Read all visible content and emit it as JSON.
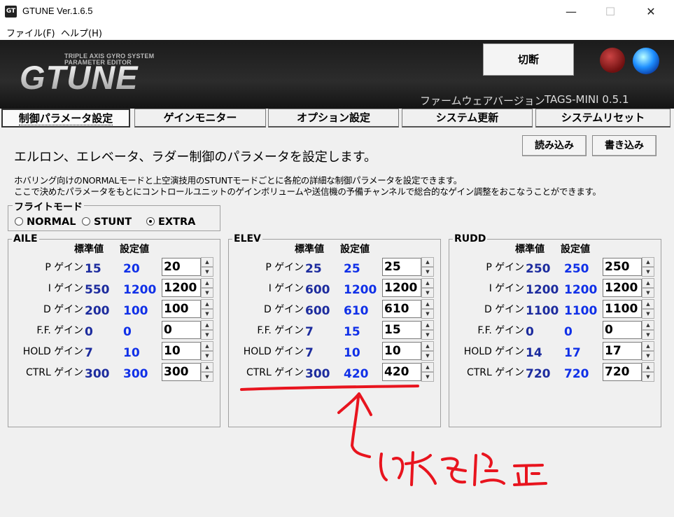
{
  "window": {
    "title": "GTUNE Ver.1.6.5",
    "icon": "GT"
  },
  "menu": [
    {
      "label": "ファイル(F)"
    },
    {
      "label": "ヘルプ(H)"
    }
  ],
  "header": {
    "logo_sub_line1": "TRIPLE AXIS GYRO SYSTEM",
    "logo_sub_line2": "PARAMETER EDITOR",
    "logo_main": "GTUNE",
    "connect_label": "切断",
    "firmware_label": "ファームウェアバージョン",
    "firmware_value": "TAGS-MINI  0.5.1"
  },
  "tabs": [
    {
      "label": "制御パラメータ設定",
      "active": true
    },
    {
      "label": "ゲインモニター"
    },
    {
      "label": "オプション設定"
    },
    {
      "label": "システム更新"
    },
    {
      "label": "システムリセット"
    }
  ],
  "content": {
    "headline": "エルロン、エレベータ、ラダー制御のパラメータを設定します。",
    "desc1": "ホバリング向けのNORMALモードと上空演技用のSTUNTモードごとに各舵の詳細な制御パラメータを設定できます。",
    "desc2": "ここで決めたパラメータをもとにコントロールユニットのゲインボリュームや送信機の予備チャンネルで総合的なゲイン調整をおこなうことができます。",
    "read_button": "読み込み",
    "write_button": "書き込み"
  },
  "flight_mode": {
    "title": "フライトモード",
    "options": [
      {
        "label": "NORMAL"
      },
      {
        "label": "STUNT"
      },
      {
        "label": "EXTRA"
      }
    ],
    "selected": "EXTRA"
  },
  "columns": {
    "std": "標準値",
    "set": "設定値"
  },
  "row_labels": [
    "P ゲイン",
    "I ゲイン",
    "D ゲイン",
    "F.F. ゲイン",
    "HOLD ゲイン",
    "CTRL ゲイン"
  ],
  "axes": [
    {
      "name": "AILE",
      "std": [
        "15",
        "550",
        "200",
        "0",
        "7",
        "300"
      ],
      "set": [
        "20",
        "1200",
        "100",
        "0",
        "10",
        "300"
      ],
      "input": [
        "20",
        "1200",
        "100",
        "0",
        "10",
        "300"
      ]
    },
    {
      "name": "ELEV",
      "std": [
        "25",
        "600",
        "600",
        "7",
        "7",
        "300"
      ],
      "set": [
        "25",
        "1200",
        "610",
        "15",
        "10",
        "420"
      ],
      "input": [
        "25",
        "1200",
        "610",
        "15",
        "10",
        "420"
      ]
    },
    {
      "name": "RUDD",
      "std": [
        "250",
        "1200",
        "1100",
        "0",
        "14",
        "720"
      ],
      "set": [
        "250",
        "1200",
        "1100",
        "0",
        "17",
        "720"
      ],
      "input": [
        "250",
        "1200",
        "1100",
        "0",
        "17",
        "720"
      ]
    }
  ],
  "annotation": {
    "text": "これを修正",
    "color": "#e8141e"
  }
}
